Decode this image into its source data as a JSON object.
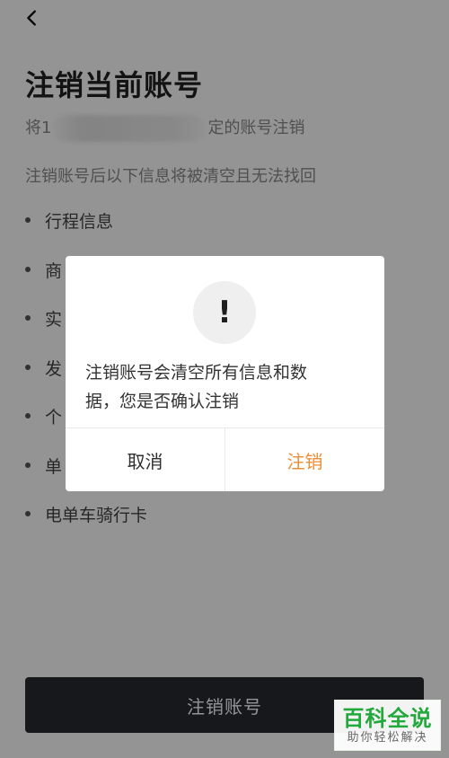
{
  "page": {
    "title": "注销当前账号",
    "binding_prefix": "将1",
    "binding_suffix": "定的账号注销",
    "warning": "注销账号后以下信息将被清空且无法找回",
    "items": [
      {
        "label": "行程信息"
      },
      {
        "label": "商"
      },
      {
        "label": "实"
      },
      {
        "label": "发"
      },
      {
        "label": "个"
      },
      {
        "label": "单"
      },
      {
        "label": "电单车骑行卡"
      }
    ],
    "bottom_button": "注销账号"
  },
  "dialog": {
    "icon": "!",
    "message_line1": "注销账号会清空所有信息和数",
    "message_line2": "据，您是否确认注销",
    "cancel": "取消",
    "confirm": "注销"
  },
  "watermark": {
    "main": "百科全说",
    "sub": "助你轻松解决"
  }
}
